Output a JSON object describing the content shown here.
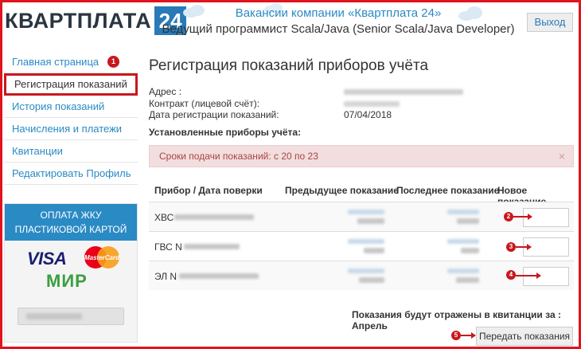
{
  "header": {
    "logo_text": "КВАРТПЛАТА",
    "logo_number": "24",
    "title": "Вакансии компании «Квартплата 24»",
    "subtitle": "Ведущий программист Scala/Java (Senior Scala/Java Developer)",
    "exit_label": "Выход"
  },
  "sidebar": {
    "items": [
      {
        "label": "Главная страница"
      },
      {
        "label": "Регистрация показаний"
      },
      {
        "label": "История показаний"
      },
      {
        "label": "Начисления и платежи"
      },
      {
        "label": "Квитанции"
      },
      {
        "label": "Редактировать Профиль"
      }
    ],
    "pay_title": "ОПЛАТА ЖКУ ПЛАСТИКОВОЙ КАРТОЙ",
    "visa": "VISA",
    "mastercard": "MasterCard",
    "mir": "МИР"
  },
  "main": {
    "title": "Регистрация показаний приборов учёта",
    "address_label": "Адрес :",
    "contract_label": "Контракт (лицевой счёт):",
    "reg_date_label": "Дата регистрации показаний:",
    "reg_date_value": "07/04/2018",
    "devices_label": "Установленные приборы учёта:",
    "alert_text": "Сроки подачи показаний: с 20 по 23",
    "alert_close": "×",
    "columns": {
      "device": "Прибор / Дата поверки",
      "previous": "Предыдущее показание",
      "last": "Последнее показание",
      "new": "Новое показание"
    },
    "rows": [
      {
        "name": "ХВС"
      },
      {
        "name": "ГВС N"
      },
      {
        "name": "ЭЛ N"
      }
    ],
    "receipt_note": "Показания будут отражены в квитанции за : Апрель",
    "submit_label": "Передать показания"
  },
  "markers": [
    "1",
    "2",
    "3",
    "4",
    "5"
  ],
  "colors": {
    "accent_blue": "#2a8ac4",
    "highlight_red": "#c8181e",
    "alert_bg": "#f2dede",
    "alert_text": "#a94442"
  }
}
